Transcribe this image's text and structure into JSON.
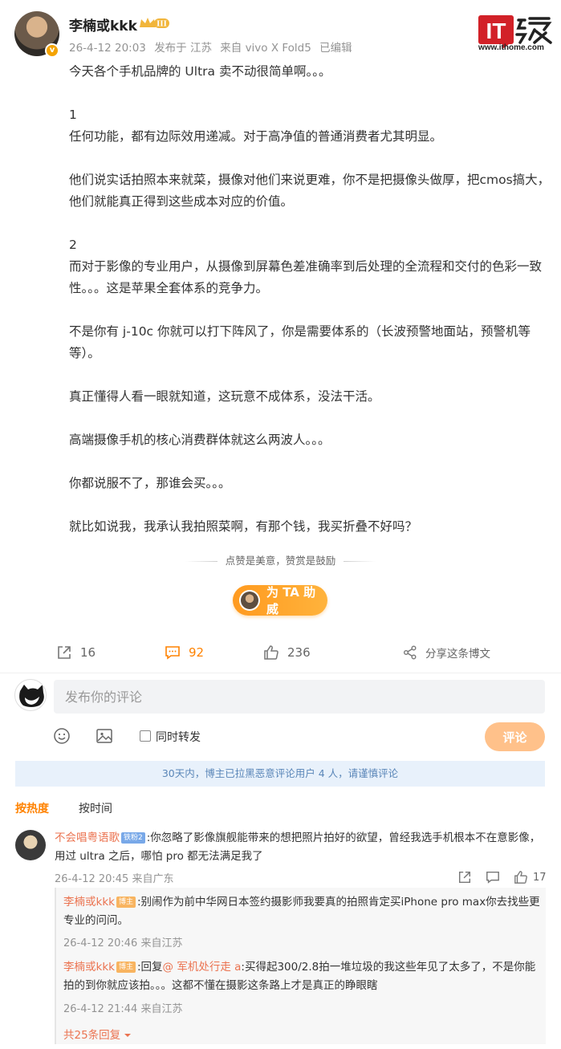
{
  "post": {
    "author": "李楠或kkk",
    "vip_badge": "III",
    "avatar_badge": "v",
    "date": "26-4-12 20:03",
    "location": "发布于 江苏",
    "source": "来自 vivo X Fold5",
    "edited": "已编辑",
    "paragraphs": [
      "今天各个手机品牌的 Ultra 卖不动很简单啊。。。",
      "",
      "1",
      "任何功能，都有边际效用递减。对于高净值的普通消费者尤其明显。",
      "",
      "他们说实话拍照本来就菜，摄像对他们来说更难，你不是把摄像头做厚，把cmos搞大，他们就能真正得到这些成本对应的价值。",
      "",
      "2",
      "而对于影像的专业用户，从摄像到屏幕色差准确率到后处理的全流程和交付的色彩一致性。。。这是苹果全套体系的竞争力。",
      "",
      "不是你有 j-10c 你就可以打下阵风了，你是需要体系的（长波预警地面站，预警机等等）。",
      "",
      "真正懂得人看一眼就知道，这玩意不成体系，没法干活。",
      "",
      "高端摄像手机的核心消费群体就这么两波人。。。",
      "",
      "你都说服不了，那谁会买。。。",
      "",
      "就比如说我，我承认我拍照菜啊，有那个钱，我买折叠不好吗？"
    ],
    "like_note": "点赞是美意，赞赏是鼓励",
    "support_label": "为 TA 助威",
    "reposts": "16",
    "comments": "92",
    "likes": "236",
    "share_label": "分享这条博文"
  },
  "watermark": {
    "brand": "IT之家",
    "url": "www.ithome.com"
  },
  "compose": {
    "placeholder": "发布你的评论",
    "repost_label": "同时转发",
    "submit_label": "评论"
  },
  "notice": "30天内，博主已拉黑恶意评论用户 4 人，请谨慎评论",
  "sort": {
    "hot": "按热度",
    "time": "按时间"
  },
  "comment": {
    "name": "不会唱粤语歌",
    "badge": "铁粉2",
    "text": ":你忽略了影像旗舰能带来的想把照片拍好的欲望，曾经我选手机根本不在意影像，用过 ultra 之后，哪怕 pro 都无法满足我了",
    "date": "26-4-12 20:45",
    "location": "来自广东",
    "likes": "17"
  },
  "replies": [
    {
      "name": "李楠或kkk",
      "badge": "博主",
      "text": ":别闹作为前中华网日本签约摄影师我要真的拍照肯定买iPhone pro max你去找些更专业的问问。",
      "date": "26-4-12 20:46",
      "location": "来自江苏"
    },
    {
      "name": "李楠或kkk",
      "badge": "博主",
      "prefix": ":回复",
      "mention": "@ 军机处行走 a",
      "text": ":买得起300/2.8拍一堆垃圾的我这些年见了太多了，不是你能拍的到你就应该拍。。。这都不懂在摄影这条路上才是真正的睁眼瞎",
      "date": "26-4-12 21:44",
      "location": "来自江苏"
    }
  ],
  "more_replies": "共25条回复"
}
